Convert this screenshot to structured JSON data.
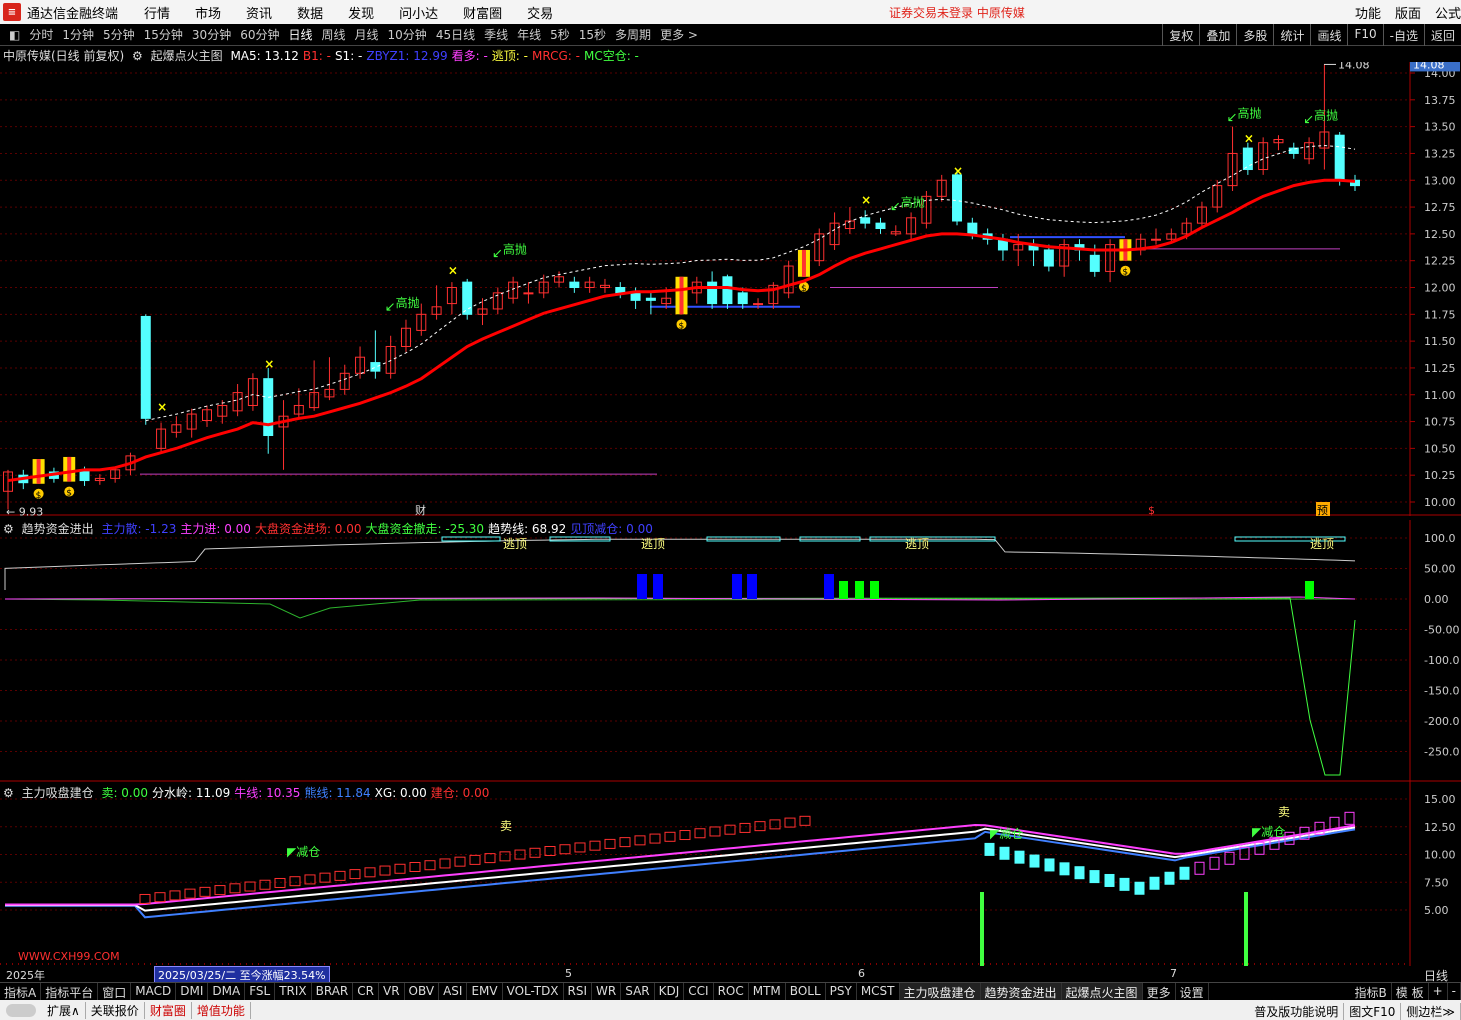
{
  "app": {
    "title": "通达信金融终端",
    "menus": [
      "行情",
      "市场",
      "资讯",
      "数据",
      "发现",
      "问小达",
      "财富圈",
      "交易"
    ],
    "notice": "证券交易未登录   中原传媒",
    "right_menus": [
      "功能",
      "版面",
      "公式"
    ]
  },
  "periods": [
    "分时",
    "1分钟",
    "5分钟",
    "15分钟",
    "30分钟",
    "60分钟",
    "日线",
    "周线",
    "月线",
    "10分钟",
    "45日线",
    "季线",
    "年线",
    "5秒",
    "15秒",
    "多周期",
    "更多 >"
  ],
  "active_period": "日线",
  "tools": [
    "复权",
    "叠加",
    "多股",
    "统计",
    "画线",
    "F10",
    "-自选",
    "返回"
  ],
  "main_panel": {
    "title": "中原传媒(日线 前复权)",
    "indicator": "起爆点火主图",
    "items": [
      {
        "t": "MA5: 13.12",
        "c": "#ffffff"
      },
      {
        "t": "B1: -",
        "c": "#ff3030"
      },
      {
        "t": "S1: -",
        "c": "#ffffff"
      },
      {
        "t": "ZBYZ1: 12.99",
        "c": "#4040ff"
      },
      {
        "t": "看多: -",
        "c": "#ff40ff"
      },
      {
        "t": "逃顶: -",
        "c": "#ffff40"
      },
      {
        "t": "MRCG: -",
        "c": "#ff3030"
      },
      {
        "t": "MC空仓: -",
        "c": "#40ff40"
      }
    ],
    "last_price": "14.08",
    "high_label": "14.08",
    "low_label": "9.93",
    "marker_cai": "财",
    "marker_yu": "预",
    "marker_dollar": "$",
    "sell_label": "高抛"
  },
  "main_axis": [
    "14.00",
    "13.75",
    "13.50",
    "13.25",
    "13.00",
    "12.75",
    "12.50",
    "12.25",
    "12.00",
    "11.75",
    "11.50",
    "11.25",
    "11.00",
    "10.75",
    "10.50",
    "10.25",
    "10.00"
  ],
  "panel2": {
    "title": "趋势资金进出",
    "items": [
      {
        "t": "主力散: -1.23",
        "c": "#4040ff"
      },
      {
        "t": "主力进: 0.00",
        "c": "#ff40ff"
      },
      {
        "t": "大盘资金进场: 0.00",
        "c": "#ff3030"
      },
      {
        "t": "大盘资金撤走: -25.30",
        "c": "#40ff40"
      },
      {
        "t": "趋势线: 68.92",
        "c": "#ffffff"
      },
      {
        "t": "见顶减仓: 0.00",
        "c": "#4040ff"
      }
    ],
    "escape_label": "逃顶"
  },
  "panel2_axis": [
    "100.0",
    "50.00",
    "0.00",
    "-50.00",
    "-100.0",
    "-150.0",
    "-200.0",
    "-250.0"
  ],
  "panel3": {
    "title": "主力吸盘建仓",
    "items": [
      {
        "t": "卖: 0.00",
        "c": "#40ff40"
      },
      {
        "t": "分水岭: 11.09",
        "c": "#ffffff"
      },
      {
        "t": "牛线: 10.35",
        "c": "#ff40ff"
      },
      {
        "t": "熊线: 11.84",
        "c": "#4080ff"
      },
      {
        "t": "XG: 0.00",
        "c": "#ffffff"
      },
      {
        "t": "建仓: 0.00",
        "c": "#ff3030"
      }
    ],
    "reduce_label": "减仓",
    "sell_label": "卖",
    "watermark": "WWW.CXH99.COM"
  },
  "panel3_axis": [
    "15.00",
    "12.50",
    "10.00",
    "7.50",
    "5.00"
  ],
  "dates": {
    "year": "2025年",
    "cursor": "2025/03/25/二",
    "change": "至今涨幅23.54%",
    "months": [
      "5",
      "6",
      "7"
    ],
    "axis_tab": "日线"
  },
  "indicator_tabs": [
    "指标A",
    "指标平台",
    "窗口",
    "MACD",
    "DMI",
    "DMA",
    "FSL",
    "TRIX",
    "BRAR",
    "CR",
    "VR",
    "OBV",
    "ASI",
    "EMV",
    "VOL-TDX",
    "RSI",
    "WR",
    "SAR",
    "KDJ",
    "CCI",
    "ROC",
    "MTM",
    "BOLL",
    "PSY",
    "MCST",
    "主力吸盘建仓",
    "趋势资金进出",
    "起爆点火主图",
    "更多",
    "设置"
  ],
  "indicator_right": [
    "指标B",
    "模 板",
    "+",
    "-"
  ],
  "status_bar": [
    "扩展∧",
    "关联报价",
    "财富圈",
    "增值功能"
  ],
  "status_right": [
    "普及版功能说明",
    "图文F10",
    "侧边栏≫"
  ],
  "colors": {
    "up": "#ff3030",
    "down": "#54ffff",
    "ma": "#ff0000",
    "accent": "#d8261c"
  },
  "chart_data": {
    "type": "candlestick",
    "ylim": [
      9.8,
      14.2
    ],
    "low": 9.93,
    "high": 14.08,
    "candles": [
      [
        10.1,
        10.28,
        9.93,
        10.3
      ],
      [
        10.25,
        10.18,
        10.12,
        10.3
      ],
      [
        10.22,
        10.3,
        10.2,
        10.35
      ],
      [
        10.28,
        10.22,
        10.18,
        10.32
      ],
      [
        10.24,
        10.32,
        10.2,
        10.36
      ],
      [
        10.3,
        10.2,
        10.15,
        10.33
      ],
      [
        10.2,
        10.22,
        10.16,
        10.26
      ],
      [
        10.22,
        10.3,
        10.18,
        10.33
      ],
      [
        10.3,
        10.43,
        10.25,
        10.46
      ],
      [
        11.73,
        10.78,
        10.72,
        11.75
      ],
      [
        10.5,
        10.68,
        10.45,
        10.74
      ],
      [
        10.65,
        10.72,
        10.6,
        10.8
      ],
      [
        10.68,
        10.82,
        10.6,
        10.87
      ],
      [
        10.76,
        10.86,
        10.7,
        10.9
      ],
      [
        10.8,
        10.9,
        10.73,
        10.95
      ],
      [
        10.85,
        11.02,
        10.8,
        11.1
      ],
      [
        10.9,
        11.15,
        10.85,
        11.2
      ],
      [
        11.15,
        10.62,
        10.45,
        11.25
      ],
      [
        10.7,
        10.8,
        10.3,
        10.95
      ],
      [
        10.82,
        10.9,
        10.78,
        11.06
      ],
      [
        10.88,
        11.02,
        10.85,
        11.32
      ],
      [
        10.98,
        11.05,
        10.95,
        11.35
      ],
      [
        11.05,
        11.2,
        11.0,
        11.28
      ],
      [
        11.2,
        11.35,
        11.15,
        11.45
      ],
      [
        11.3,
        11.22,
        11.15,
        11.6
      ],
      [
        11.2,
        11.45,
        11.15,
        11.55
      ],
      [
        11.45,
        11.62,
        11.4,
        11.7
      ],
      [
        11.6,
        11.75,
        11.55,
        11.85
      ],
      [
        11.75,
        11.82,
        11.7,
        12.02
      ],
      [
        11.85,
        12.0,
        11.75,
        12.05
      ],
      [
        12.05,
        11.75,
        11.7,
        12.08
      ],
      [
        11.75,
        11.8,
        11.65,
        11.9
      ],
      [
        11.8,
        11.95,
        11.75,
        12.0
      ],
      [
        11.9,
        12.05,
        11.85,
        12.1
      ],
      [
        11.95,
        11.95,
        11.85,
        12.05
      ],
      [
        11.95,
        12.05,
        11.9,
        12.12
      ],
      [
        12.05,
        12.1,
        12.0,
        12.15
      ],
      [
        12.05,
        12.0,
        11.95,
        12.1
      ],
      [
        12.0,
        12.05,
        11.95,
        12.1
      ],
      [
        12.0,
        12.02,
        11.95,
        12.08
      ],
      [
        12.0,
        11.95,
        11.9,
        12.05
      ],
      [
        11.95,
        11.88,
        11.8,
        12.0
      ],
      [
        11.9,
        11.88,
        11.75,
        11.95
      ],
      [
        11.85,
        11.9,
        11.8,
        12.0
      ],
      [
        11.8,
        12.0,
        11.75,
        12.05
      ],
      [
        11.95,
        12.05,
        11.85,
        12.1
      ],
      [
        12.05,
        11.85,
        11.8,
        12.15
      ],
      [
        12.1,
        11.85,
        11.8,
        12.12
      ],
      [
        11.95,
        11.85,
        11.8,
        12.0
      ],
      [
        11.85,
        11.85,
        11.8,
        11.9
      ],
      [
        11.85,
        12.02,
        11.8,
        12.05
      ],
      [
        11.95,
        12.2,
        11.9,
        12.25
      ],
      [
        12.15,
        12.25,
        12.1,
        12.32
      ],
      [
        12.25,
        12.5,
        12.2,
        12.55
      ],
      [
        12.4,
        12.6,
        12.35,
        12.7
      ],
      [
        12.55,
        12.62,
        12.5,
        12.75
      ],
      [
        12.65,
        12.6,
        12.55,
        12.72
      ],
      [
        12.6,
        12.55,
        12.5,
        12.65
      ],
      [
        12.5,
        12.52,
        12.48,
        12.58
      ],
      [
        12.5,
        12.65,
        12.45,
        12.7
      ],
      [
        12.6,
        12.85,
        12.55,
        12.9
      ],
      [
        12.85,
        13.0,
        12.8,
        13.05
      ],
      [
        13.05,
        12.62,
        12.58,
        13.1
      ],
      [
        12.6,
        12.5,
        12.45,
        12.65
      ],
      [
        12.5,
        12.45,
        12.4,
        12.55
      ],
      [
        12.45,
        12.35,
        12.25,
        12.5
      ],
      [
        12.35,
        12.4,
        12.2,
        12.5
      ],
      [
        12.4,
        12.35,
        12.2,
        12.45
      ],
      [
        12.35,
        12.2,
        12.15,
        12.4
      ],
      [
        12.2,
        12.4,
        12.1,
        12.45
      ],
      [
        12.4,
        12.35,
        12.25,
        12.45
      ],
      [
        12.3,
        12.15,
        12.1,
        12.4
      ],
      [
        12.15,
        12.4,
        12.05,
        12.45
      ],
      [
        12.3,
        12.35,
        12.25,
        12.42
      ],
      [
        12.35,
        12.45,
        12.3,
        12.5
      ],
      [
        12.45,
        12.45,
        12.4,
        12.55
      ],
      [
        12.45,
        12.5,
        12.42,
        12.55
      ],
      [
        12.5,
        12.6,
        12.45,
        12.65
      ],
      [
        12.6,
        12.75,
        12.55,
        12.8
      ],
      [
        12.75,
        12.95,
        12.7,
        13.0
      ],
      [
        12.95,
        13.25,
        12.9,
        13.5
      ],
      [
        13.3,
        13.1,
        13.05,
        13.35
      ],
      [
        13.1,
        13.35,
        13.05,
        13.4
      ],
      [
        13.35,
        13.38,
        13.28,
        13.42
      ],
      [
        13.3,
        13.25,
        13.2,
        13.35
      ],
      [
        13.2,
        13.35,
        13.15,
        13.4
      ],
      [
        13.3,
        13.45,
        13.1,
        14.08
      ],
      [
        13.42,
        13.0,
        12.95,
        13.45
      ],
      [
        13.0,
        12.95,
        12.9,
        13.05
      ]
    ],
    "ma": [
      10.2,
      10.22,
      10.24,
      10.26,
      10.28,
      10.3,
      10.3,
      10.32,
      10.36,
      10.42,
      10.46,
      10.5,
      10.55,
      10.6,
      10.64,
      10.68,
      10.74,
      10.72,
      10.75,
      10.78,
      10.8,
      10.84,
      10.88,
      10.92,
      10.97,
      11.02,
      11.08,
      11.15,
      11.25,
      11.35,
      11.45,
      11.52,
      11.58,
      11.64,
      11.7,
      11.76,
      11.8,
      11.84,
      11.88,
      11.92,
      11.94,
      11.96,
      11.96,
      11.97,
      11.98,
      12.0,
      12.0,
      12.0,
      11.98,
      11.97,
      11.98,
      12.02,
      12.06,
      12.12,
      12.2,
      12.27,
      12.32,
      12.36,
      12.4,
      12.44,
      12.48,
      12.5,
      12.5,
      12.49,
      12.47,
      12.45,
      12.42,
      12.4,
      12.38,
      12.37,
      12.36,
      12.35,
      12.35,
      12.35,
      12.36,
      12.38,
      12.42,
      12.48,
      12.56,
      12.63,
      12.7,
      12.78,
      12.85,
      12.9,
      12.95,
      12.98,
      13.0,
      13.0,
      12.99
    ]
  }
}
